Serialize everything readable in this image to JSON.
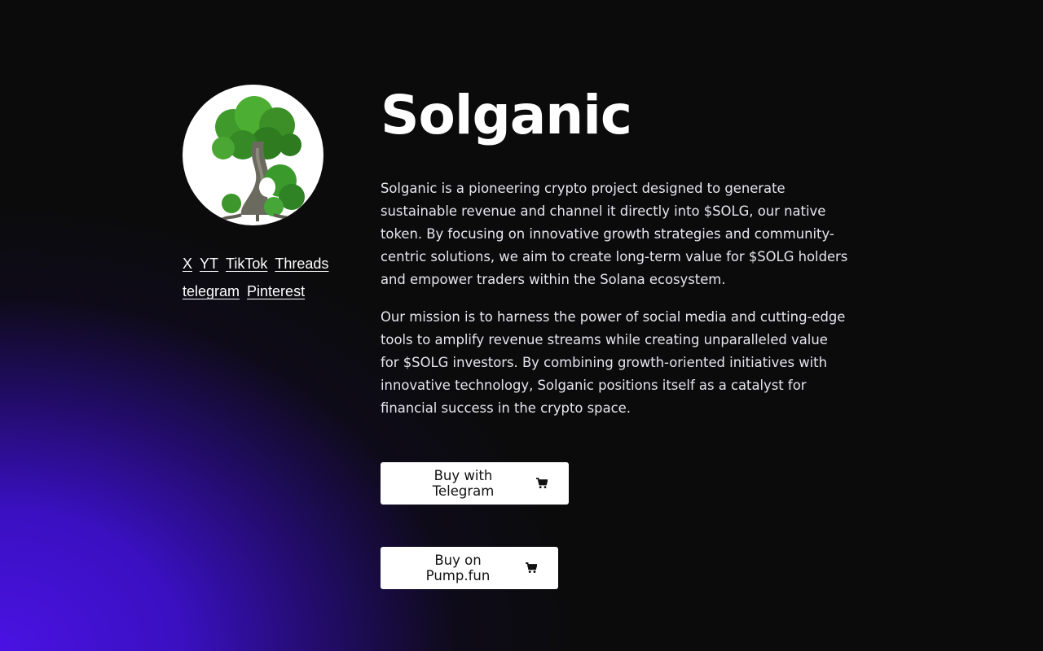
{
  "header": {
    "title": "Solganic"
  },
  "avatar": {
    "icon": "tree-logo-icon"
  },
  "social": {
    "links": [
      "X",
      "YT",
      "TikTok",
      "Threads",
      "telegram",
      "Pinterest"
    ]
  },
  "about": {
    "paragraph_1": "Solganic is a pioneering crypto project designed to generate sustainable revenue and channel it directly into $SOLG, our native token. By focusing on innovative growth strategies and community-centric solutions, we aim to create long-term value for $SOLG holders and empower traders within the Solana ecosystem.",
    "paragraph_2": "Our mission is to harness the power of social media and cutting-edge tools to amplify revenue streams while creating unparalleled value for $SOLG investors. By combining growth-oriented initiatives with innovative technology, Solganic positions itself as a catalyst for financial success in the crypto space."
  },
  "actions": {
    "buy_telegram_label": "Buy with Telegram",
    "buy_pump_label": "Buy on Pump.fun",
    "icon": "cart-icon"
  },
  "colors": {
    "background": "#0b0b0c",
    "accent_gradient": "#4a12e3",
    "button_bg": "#ffffff",
    "button_text": "#111111"
  }
}
